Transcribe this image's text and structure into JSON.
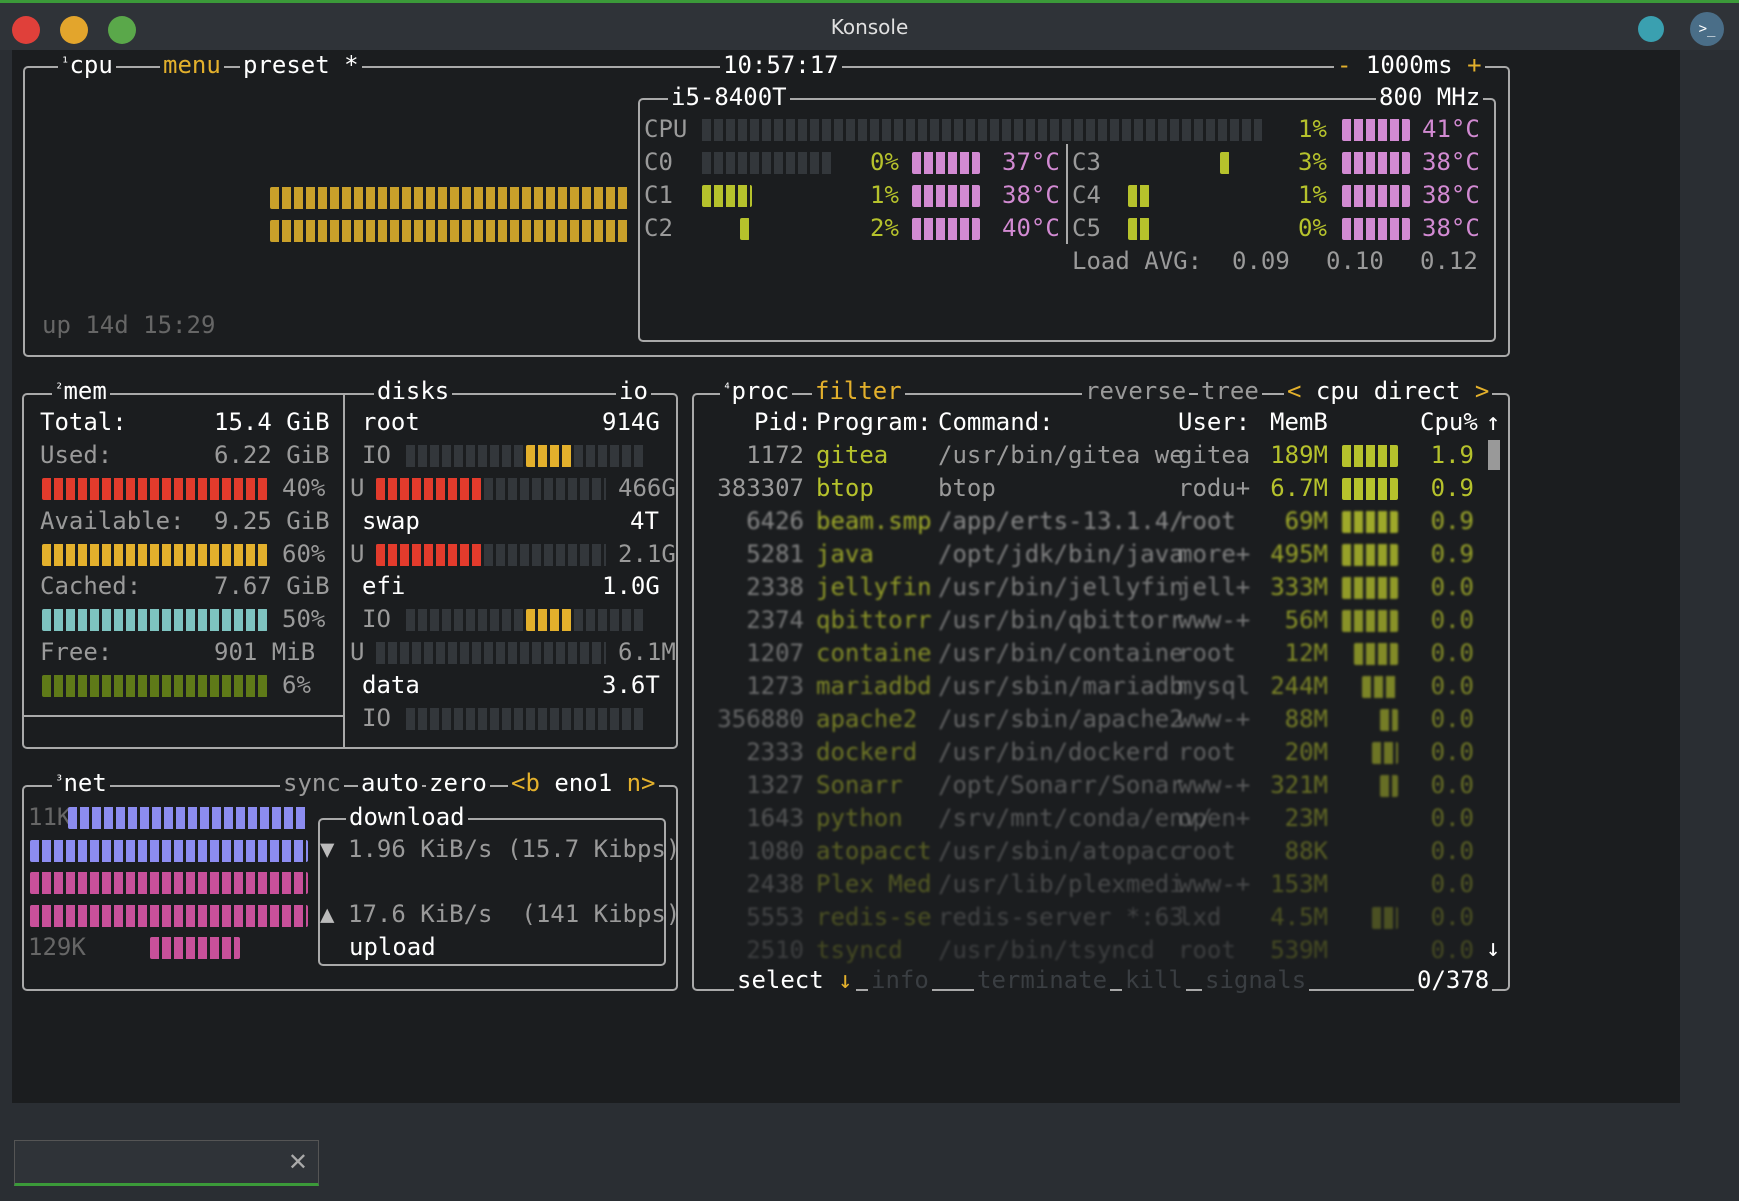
{
  "window": {
    "title": "Konsole"
  },
  "cpu": {
    "label": "cpu",
    "num": "¹",
    "menu": "menu",
    "preset": "preset *",
    "clock": "10:57:17",
    "minus": "-",
    "interval": "1000ms",
    "plus": "+",
    "model": "i5-8400T",
    "freq": "800 MHz",
    "uptime": "up 14d 15:29",
    "total": {
      "label": "CPU",
      "pct": "1%",
      "temp": "41°C"
    },
    "cores": [
      {
        "label": "C0",
        "pct": "0%",
        "temp": "37°C"
      },
      {
        "label": "C1",
        "pct": "1%",
        "temp": "38°C"
      },
      {
        "label": "C2",
        "pct": "2%",
        "temp": "40°C"
      },
      {
        "label": "C3",
        "pct": "3%",
        "temp": "38°C"
      },
      {
        "label": "C4",
        "pct": "1%",
        "temp": "38°C"
      },
      {
        "label": "C5",
        "pct": "0%",
        "temp": "38°C"
      }
    ],
    "load": {
      "label": "Load AVG:",
      "v1": "0.09",
      "v2": "0.10",
      "v3": "0.12"
    }
  },
  "mem": {
    "num": "²",
    "label": "mem",
    "total_label": "Total:",
    "total": "15.4 GiB",
    "used": {
      "label": "Used:",
      "value": "6.22 GiB",
      "pct": "40%"
    },
    "available": {
      "label": "Available:",
      "value": "9.25 GiB",
      "pct": "60%"
    },
    "cached": {
      "label": "Cached:",
      "value": "7.67 GiB",
      "pct": "50%"
    },
    "free": {
      "label": "Free:",
      "value": "901 MiB",
      "pct": "6%"
    }
  },
  "disks": {
    "label": "disks",
    "io": "io",
    "items": [
      {
        "name": "root",
        "size": "914G",
        "io": "IO",
        "u": "U",
        "used": "466G"
      },
      {
        "name": "swap",
        "size": "4T",
        "u": "U",
        "used": "2.1G"
      },
      {
        "name": "efi",
        "size": "1.0G",
        "io": "IO",
        "u": "U",
        "used": "6.1M"
      },
      {
        "name": "data",
        "size": "3.6T",
        "io": "IO"
      }
    ]
  },
  "net": {
    "num": "³",
    "label": "net",
    "sync": "sync",
    "auto": "auto",
    "zero": "zero",
    "prev": "<b",
    "iface": "eno1",
    "next": "n>",
    "top": "11K",
    "bottom": "129K",
    "download_label": "download",
    "download": "1.96 KiB/s (15.7 Kibps)",
    "upload": "17.6 KiB/s  (141 Kibps)",
    "upload_label": "upload"
  },
  "proc": {
    "num": "⁴",
    "label": "proc",
    "filter": "filter",
    "reverse": "reverse",
    "tree": "tree",
    "sort_prev": "<",
    "sort": "cpu direct",
    "sort_next": ">",
    "headers": {
      "pid": "Pid:",
      "program": "Program:",
      "command": "Command:",
      "user": "User:",
      "mem": "MemB",
      "cpu": "Cpu%"
    },
    "rows": [
      {
        "pid": "1172",
        "program": "gitea",
        "command": "/usr/bin/gitea we",
        "user": "gitea",
        "mem": "189M",
        "cpu": "1.9"
      },
      {
        "pid": "383307",
        "program": "btop",
        "command": "btop",
        "user": "rodu+",
        "mem": "6.7M",
        "cpu": "0.9"
      },
      {
        "pid": "6426",
        "program": "beam.smp",
        "command": "/app/erts-13.1.4/",
        "user": "root",
        "mem": "69M",
        "cpu": "0.9"
      },
      {
        "pid": "5281",
        "program": "java",
        "command": "/opt/jdk/bin/java",
        "user": "more+",
        "mem": "495M",
        "cpu": "0.9"
      },
      {
        "pid": "2338",
        "program": "jellyfin",
        "command": "/usr/bin/jellyfin",
        "user": "jell+",
        "mem": "333M",
        "cpu": "0.0"
      },
      {
        "pid": "2374",
        "program": "qbittorr",
        "command": "/usr/bin/qbittorr",
        "user": "www-+",
        "mem": "56M",
        "cpu": "0.0"
      },
      {
        "pid": "1207",
        "program": "containe",
        "command": "/usr/bin/containe",
        "user": "root",
        "mem": "12M",
        "cpu": "0.0"
      },
      {
        "pid": "1273",
        "program": "mariadbd",
        "command": "/usr/sbin/mariadb",
        "user": "mysql",
        "mem": "244M",
        "cpu": "0.0"
      },
      {
        "pid": "356880",
        "program": "apache2",
        "command": "/usr/sbin/apache2",
        "user": "www-+",
        "mem": "88M",
        "cpu": "0.0"
      },
      {
        "pid": "2333",
        "program": "dockerd",
        "command": "/usr/bin/dockerd",
        "user": "root",
        "mem": "20M",
        "cpu": "0.0"
      },
      {
        "pid": "1327",
        "program": "Sonarr",
        "command": "/opt/Sonarr/Sonar",
        "user": "www-+",
        "mem": "321M",
        "cpu": "0.0"
      },
      {
        "pid": "1643",
        "program": "python",
        "command": "/srv/mnt/conda/env/",
        "user": "open+",
        "mem": "23M",
        "cpu": "0.0"
      },
      {
        "pid": "1080",
        "program": "atopacct",
        "command": "/usr/sbin/atopacc",
        "user": "root",
        "mem": "88K",
        "cpu": "0.0"
      },
      {
        "pid": "2438",
        "program": "Plex Med",
        "command": "/usr/lib/plexmedi",
        "user": "www-+",
        "mem": "153M",
        "cpu": "0.0"
      },
      {
        "pid": "5553",
        "program": "redis-se",
        "command": "redis-server *:63",
        "user": "lxd",
        "mem": "4.5M",
        "cpu": "0.0"
      },
      {
        "pid": "2510",
        "program": "tsyncd",
        "command": "/usr/bin/tsyncd",
        "user": "root",
        "mem": "539M",
        "cpu": "0.0"
      }
    ],
    "select": "select",
    "info": "info",
    "terminate": "terminate",
    "kill": "kill",
    "signals": "signals",
    "count": "0/378"
  },
  "colors": {
    "accent": "#e3b02c",
    "border": "#a9a9a9",
    "bg": "#1b1d1f"
  }
}
